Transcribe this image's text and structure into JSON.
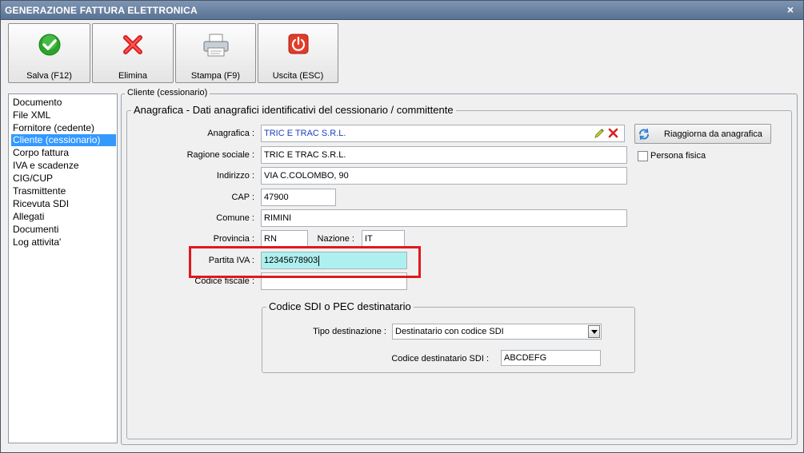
{
  "window": {
    "title": "GENERAZIONE FATTURA ELETTRONICA",
    "close_symbol": "×"
  },
  "toolbar": {
    "save_label": "Salva (F12)",
    "delete_label": "Elimina",
    "print_label": "Stampa (F9)",
    "exit_label": "Uscita (ESC)"
  },
  "nav": {
    "items": [
      {
        "label": "Documento"
      },
      {
        "label": "File XML"
      },
      {
        "label": "Fornitore (cedente)"
      },
      {
        "label": "Cliente (cessionario)"
      },
      {
        "label": "Corpo fattura"
      },
      {
        "label": "IVA e scadenze"
      },
      {
        "label": "CIG/CUP"
      },
      {
        "label": "Trasmittente"
      },
      {
        "label": "Ricevuta SDI"
      },
      {
        "label": "Allegati"
      },
      {
        "label": "Documenti"
      },
      {
        "label": "Log attivita'"
      }
    ],
    "selected": "Cliente (cessionario)"
  },
  "panel": {
    "group_title": "Cliente (cessionario)",
    "section_title": "Anagrafica - Dati anagrafici identificativi del cessionario / committente"
  },
  "form": {
    "anagrafica_label": "Anagrafica :",
    "anagrafica_value": "TRIC E TRAC S.R.L.",
    "ragione_label": "Ragione sociale :",
    "ragione_value": "TRIC E TRAC S.R.L.",
    "indirizzo_label": "Indirizzo :",
    "indirizzo_value": "VIA C.COLOMBO, 90",
    "cap_label": "CAP :",
    "cap_value": "47900",
    "comune_label": "Comune :",
    "comune_value": "RIMINI",
    "provincia_label": "Provincia :",
    "provincia_value": "RN",
    "nazione_label": "Nazione :",
    "nazione_value": "IT",
    "piva_label": "Partita IVA :",
    "piva_value": "12345678903",
    "cf_label": "Codice fiscale :",
    "cf_value": ""
  },
  "side": {
    "refresh_label": "Riaggiorna da anagrafica",
    "persona_label": "Persona fisica",
    "persona_checked": false
  },
  "sdi": {
    "title": "Codice SDI o PEC destinatario",
    "tipo_label": "Tipo destinazione :",
    "tipo_value": "Destinatario con codice SDI",
    "codice_label": "Codice destinatario SDI :",
    "codice_value": "ABCDEFG"
  },
  "colors": {
    "highlight": "#e0181e",
    "selected_nav": "#3399ff",
    "piva_field": "#aef0f0",
    "link_text": "#1a3ec2"
  }
}
